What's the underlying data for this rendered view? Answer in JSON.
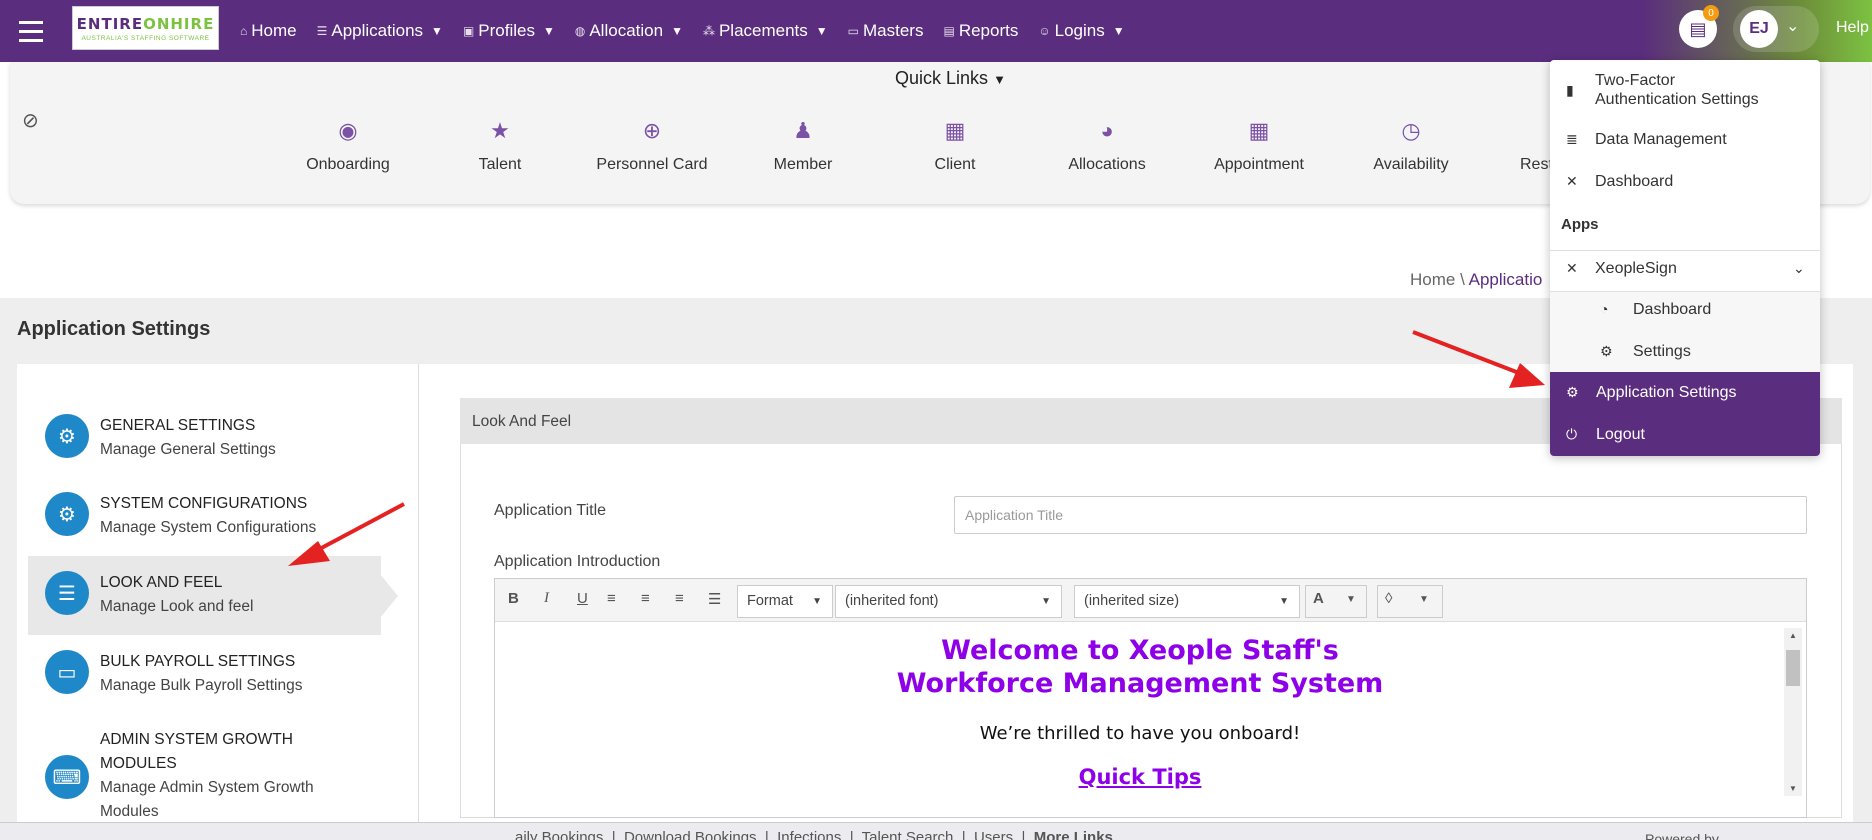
{
  "nav": {
    "logo_main_a": "ENTIRE",
    "logo_main_b": "ONHIRE",
    "logo_tagline": "AUSTRALIA'S STAFFING SOFTWARE",
    "items": [
      {
        "label": "Home",
        "icon": "home-icon",
        "chevron": false
      },
      {
        "label": "Applications",
        "icon": "list-icon",
        "chevron": true
      },
      {
        "label": "Profiles",
        "icon": "id-card-icon",
        "chevron": true
      },
      {
        "label": "Allocation",
        "icon": "globe-icon",
        "chevron": true
      },
      {
        "label": "Placements",
        "icon": "sitemap-icon",
        "chevron": true
      },
      {
        "label": "Masters",
        "icon": "folder-icon",
        "chevron": false
      },
      {
        "label": "Reports",
        "icon": "file-icon",
        "chevron": false
      },
      {
        "label": "Logins",
        "icon": "user-icon",
        "chevron": true
      }
    ],
    "notification_count": "0",
    "avatar_initials": "EJ",
    "help_label": "Help"
  },
  "quick_links": {
    "title": "Quick Links",
    "items": [
      {
        "label": "Onboarding",
        "icon": "user-circle-icon"
      },
      {
        "label": "Talent",
        "icon": "star-icon"
      },
      {
        "label": "Personnel Card",
        "icon": "search-plus-icon"
      },
      {
        "label": "Member",
        "icon": "user-icon"
      },
      {
        "label": "Client",
        "icon": "building-icon"
      },
      {
        "label": "Allocations",
        "icon": "pie-chart-icon"
      },
      {
        "label": "Appointment",
        "icon": "calendar-icon"
      },
      {
        "label": "Availability",
        "icon": "clock-icon"
      },
      {
        "label": "Rest",
        "icon": "none"
      }
    ]
  },
  "breadcrumb": {
    "home": "Home",
    "separator": "\\",
    "current": "Applicatio"
  },
  "page": {
    "title": "Application Settings"
  },
  "settings_menu": [
    {
      "title": "GENERAL SETTINGS",
      "subtitle": "Manage General Settings",
      "icon": "gear-icon"
    },
    {
      "title": "SYSTEM CONFIGURATIONS",
      "subtitle": "Manage System Configurations",
      "icon": "cogs-icon"
    },
    {
      "title": "LOOK AND FEEL",
      "subtitle": "Manage Look and feel",
      "icon": "sliders-icon",
      "active": true
    },
    {
      "title": "BULK PAYROLL SETTINGS",
      "subtitle": "Manage Bulk Payroll Settings",
      "icon": "credit-card-icon"
    },
    {
      "title_line1": "ADMIN SYSTEM GROWTH",
      "title_line2": "MODULES",
      "subtitle_line1": "Manage Admin System Growth",
      "subtitle_line2": "Modules",
      "icon": "keyboard-icon"
    }
  ],
  "look_and_feel": {
    "section_title": "Look And Feel",
    "app_title_label": "Application Title",
    "app_title_placeholder": "Application Title",
    "app_title_value": "",
    "app_intro_label": "Application Introduction",
    "toolbar": {
      "bold": "B",
      "italic": "I",
      "underline": "U",
      "format": "Format",
      "font": "(inherited font)",
      "size": "(inherited size)",
      "font_color": "A"
    },
    "content": {
      "heading_line1": "Welcome to Xeople Staff's",
      "heading_line2": "Workforce Management System",
      "body": "We’re thrilled to have you onboard!",
      "link": "Quick Tips"
    }
  },
  "footer": {
    "links": [
      "aily Bookings",
      "Download Bookings",
      "Infections",
      "Talent Search",
      "Users",
      "More Links"
    ],
    "powered_by": "Powered by"
  },
  "user_menu": {
    "items": [
      {
        "label_line1": "Two-Factor",
        "label_line2": "Authentication Settings",
        "icon": "lock-icon"
      },
      {
        "label": "Data Management",
        "icon": "database-icon"
      },
      {
        "label": "Dashboard",
        "icon": "xeople-icon"
      }
    ],
    "apps_header": "Apps",
    "xeoplesign": {
      "label": "XeopleSign",
      "icon": "xeople-icon",
      "sub": [
        {
          "label": "Dashboard",
          "icon": "tachometer-icon"
        },
        {
          "label": "Settings",
          "icon": "cogs-icon"
        }
      ]
    },
    "app_settings": "Application Settings",
    "logout": "Logout"
  },
  "colors": {
    "brand_purple": "#5b2d7e",
    "accent_green": "#7cc242",
    "icon_blue": "#1e88c8",
    "editor_heading": "#8e00e8",
    "annotation_red": "#e52222"
  }
}
